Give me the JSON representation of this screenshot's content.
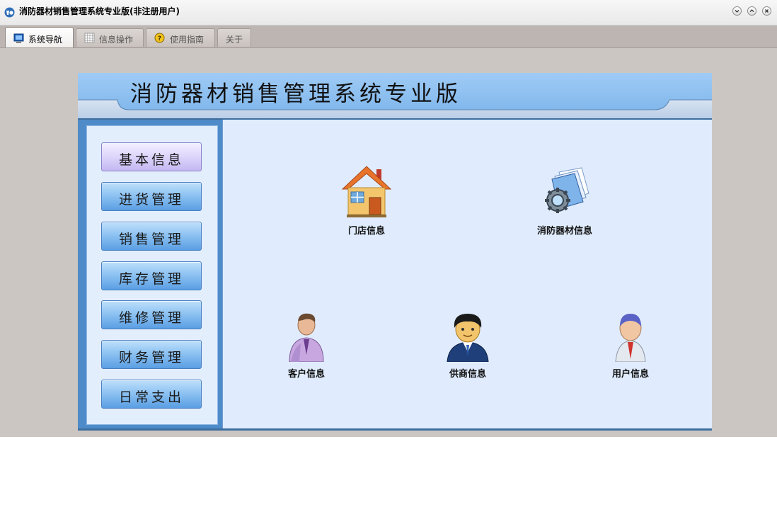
{
  "window": {
    "title": "消防器材销售管理系统专业版(非注册用户)"
  },
  "tabs": [
    {
      "label": "系统导航",
      "icon": "monitor-icon",
      "active": true
    },
    {
      "label": "信息操作",
      "icon": "grid-icon",
      "active": false
    },
    {
      "label": "使用指南",
      "icon": "help-icon",
      "active": false
    },
    {
      "label": "关于",
      "icon": "",
      "active": false
    }
  ],
  "header": {
    "title": "消防器材销售管理系统专业版"
  },
  "sidebar": {
    "items": [
      {
        "label": "基本信息",
        "active": true
      },
      {
        "label": "进货管理",
        "active": false
      },
      {
        "label": "销售管理",
        "active": false
      },
      {
        "label": "库存管理",
        "active": false
      },
      {
        "label": "维修管理",
        "active": false
      },
      {
        "label": "财务管理",
        "active": false
      },
      {
        "label": "日常支出",
        "active": false
      }
    ]
  },
  "content": {
    "items": [
      {
        "label": "门店信息",
        "icon": "house-icon"
      },
      {
        "label": "消防器材信息",
        "icon": "gear-document-icon"
      },
      {
        "label": "客户信息",
        "icon": "customer-icon"
      },
      {
        "label": "供商信息",
        "icon": "supplier-icon"
      },
      {
        "label": "用户信息",
        "icon": "user-icon"
      }
    ]
  },
  "colors": {
    "header_blue": "#8dbff0",
    "sidebar_blue": "#4f8bc9",
    "content_bg": "#e0ecfd",
    "active_button": "#ddd5fb"
  }
}
